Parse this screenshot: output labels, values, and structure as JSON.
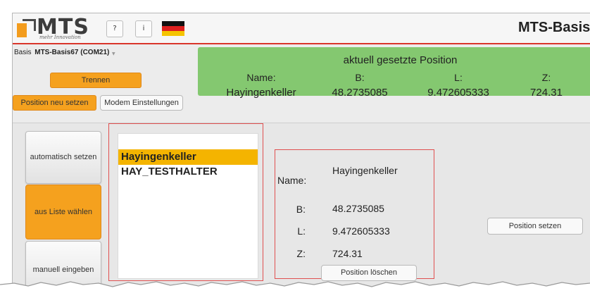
{
  "header": {
    "logo_text": "MTS",
    "logo_tagline": "mehr Innovation",
    "help_label": "?",
    "info_label": "i",
    "language_flag": "german-flag-icon",
    "app_title": "MTS-Basis"
  },
  "connection": {
    "basis_label": "Basis",
    "basis_value": "MTS-Basis67 (COM21)",
    "disconnect_label": "Trennen",
    "reset_position_label": "Position neu setzen",
    "modem_settings_label": "Modem Einstellungen"
  },
  "current_position": {
    "title": "aktuell gesetzte Position",
    "headers": [
      "Name:",
      "B:",
      "L:",
      "Z:"
    ],
    "values": [
      "Hayingenkeller",
      "48.2735085",
      "9.472605333",
      "724.31"
    ],
    "background_color": "#84c870"
  },
  "modes": [
    {
      "label": "automatisch setzen",
      "active": false
    },
    {
      "label": "aus Liste wählen",
      "active": true
    },
    {
      "label": "manuell eingeben",
      "active": false
    }
  ],
  "location_list": {
    "items": [
      "Hayingenkeller",
      "HAY_TESTHALTER"
    ],
    "selected_index": 0,
    "selected_color": "#f4b400"
  },
  "details": {
    "name_label": "Name:",
    "name_value": "Hayingenkeller",
    "b_label": "B:",
    "b_value": "48.2735085",
    "l_label": "L:",
    "l_value": "9.472605333",
    "z_label": "Z:",
    "z_value": "724.31",
    "delete_label": "Position löschen"
  },
  "actions": {
    "set_position_label": "Position setzen"
  },
  "colors": {
    "accent_orange": "#f5a11e",
    "title_bar_rule": "#d9362b",
    "highlight_border": "#e05050"
  }
}
